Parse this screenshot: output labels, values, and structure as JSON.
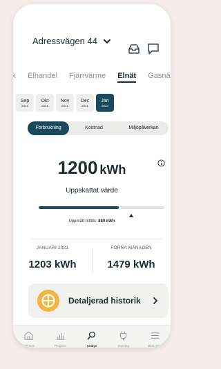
{
  "header": {
    "address": "Adressvägen 44"
  },
  "tabs": [
    "plick",
    "Elhandel",
    "Fjärrvärme",
    "Elnät",
    "Gasnät"
  ],
  "active_tab_index": 3,
  "months": [
    {
      "m": "Sep",
      "y": "2021"
    },
    {
      "m": "Okt",
      "y": "2021"
    },
    {
      "m": "Nov",
      "y": "2021"
    },
    {
      "m": "Dec",
      "y": "2021"
    },
    {
      "m": "Jan",
      "y": "2022"
    }
  ],
  "active_month_index": 4,
  "segments": [
    "Förbrukning",
    "Kostnad",
    "Miljöpåverkan"
  ],
  "active_segment_index": 0,
  "consumption": {
    "value": "1200",
    "unit": "kWh",
    "caption": "Uppskattat värde",
    "measured_label": "Uppmätt hittills:",
    "measured_value": "889 kWh",
    "progress_fraction": 0.64
  },
  "stats": [
    {
      "label": "JANUARI 2021",
      "value": "1203 kWh"
    },
    {
      "label": "FÖRRA MÅNADEN",
      "value": "1479 kWh"
    }
  ],
  "history": {
    "label": "Detaljerad historik"
  },
  "nav": [
    {
      "label": "Mitt hem",
      "icon": "home-icon"
    },
    {
      "label": "Prognos",
      "icon": "chart-icon"
    },
    {
      "label": "Analys",
      "icon": "search-icon"
    },
    {
      "label": "Styrning",
      "icon": "plug-icon"
    },
    {
      "label": "Mina sidor",
      "icon": "menu-icon"
    }
  ],
  "active_nav_index": 2,
  "colors": {
    "accent": "#1b4a5e",
    "history_icon": "#f0b63f"
  }
}
